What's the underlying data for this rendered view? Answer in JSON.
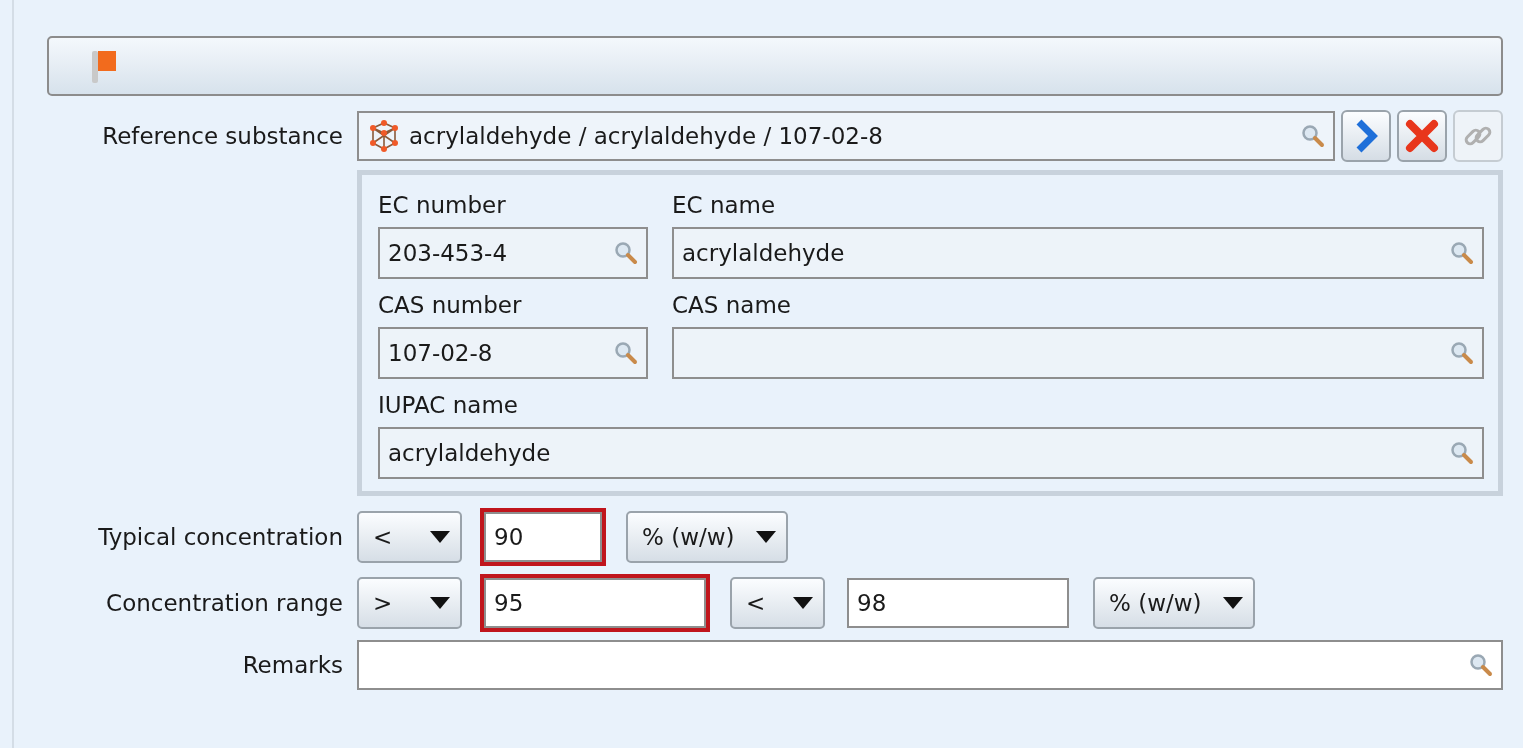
{
  "reference_substance": {
    "label": "Reference substance",
    "value": "acrylaldehyde / acrylaldehyde / 107-02-8",
    "buttons": [
      {
        "kind": "open",
        "disabled": false
      },
      {
        "kind": "delete",
        "disabled": false
      },
      {
        "kind": "link",
        "disabled": true
      }
    ]
  },
  "identifiers": [
    [
      {
        "label": "EC number",
        "value": "203-453-4"
      },
      {
        "label": "EC name",
        "value": "acrylaldehyde"
      }
    ],
    [
      {
        "label": "CAS number",
        "value": "107-02-8"
      },
      {
        "label": "CAS name"
      }
    ],
    [
      {
        "label": "IUPAC name",
        "value": "acrylaldehyde"
      }
    ]
  ],
  "typical_concentration": {
    "label": "Typical concentration",
    "qualifier": "<",
    "value": "90",
    "highlighted": true,
    "unit": "% (w/w)"
  },
  "concentration_range": {
    "label": "Concentration range",
    "lower_qualifier": ">",
    "lower_value": "95",
    "lower_highlighted": true,
    "upper_qualifier": "<",
    "upper_value": "98",
    "upper_highlighted": false,
    "unit": "% (w/w)"
  },
  "remarks": {
    "label": "Remarks"
  }
}
